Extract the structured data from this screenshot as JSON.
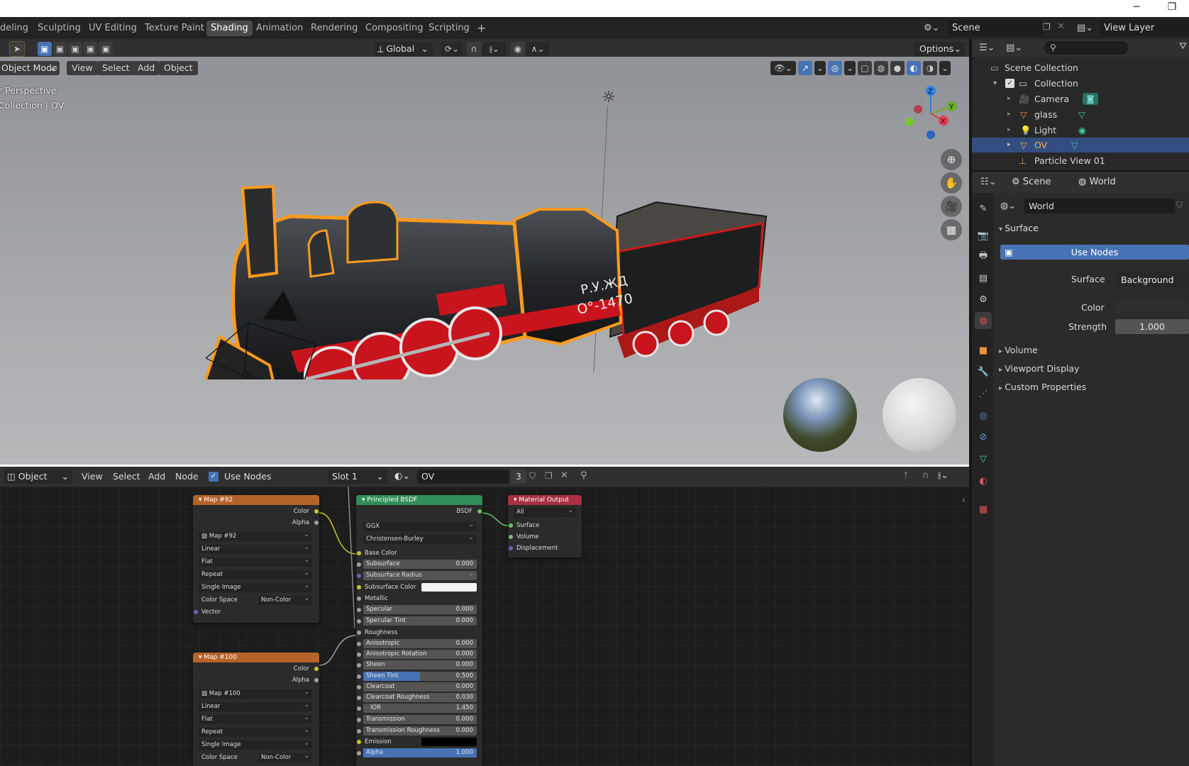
{
  "os": {
    "minimize": "─",
    "maximize": "❐"
  },
  "workspaces": [
    {
      "label": "deling",
      "active": false
    },
    {
      "label": "Sculpting",
      "active": false
    },
    {
      "label": "UV Editing",
      "active": false
    },
    {
      "label": "Texture Paint",
      "active": false
    },
    {
      "label": "Shading",
      "active": true
    },
    {
      "label": "Animation",
      "active": false
    },
    {
      "label": "Rendering",
      "active": false
    },
    {
      "label": "Compositing",
      "active": false
    },
    {
      "label": "Scripting",
      "active": false
    }
  ],
  "topbar": {
    "add_tab": "+",
    "scene_label": "Scene",
    "view_layer_label": "View Layer"
  },
  "viewport_header": {
    "transform_orientation": "Global",
    "options": "Options",
    "mode": "Object Mode",
    "menus": [
      "View",
      "Select",
      "Add",
      "Object"
    ]
  },
  "viewport": {
    "overlay_line1": "r Perspective",
    "overlay_line2": "Collection | OV",
    "gizmo": {
      "z": "Z",
      "y": "Y",
      "x": "X"
    },
    "train_plate": "Р.У.ЖД",
    "train_number": "О°-1470"
  },
  "node_header": {
    "editor_type": "Object",
    "menus": [
      "View",
      "Select",
      "Add",
      "Node"
    ],
    "use_nodes_label": "Use Nodes",
    "slot": "Slot 1",
    "material": "OV",
    "users": "3"
  },
  "nodes": {
    "map92": {
      "title": "Map #92",
      "out_color": "Color",
      "out_alpha": "Alpha",
      "image": "Map #92",
      "interpolation": "Linear",
      "projection": "Flat",
      "extension": "Repeat",
      "source": "Single Image",
      "color_space_label": "Color Space",
      "color_space": "Non-Color",
      "vector": "Vector"
    },
    "map100": {
      "title": "Map #100",
      "out_color": "Color",
      "out_alpha": "Alpha",
      "image": "Map #100",
      "interpolation": "Linear",
      "projection": "Flat",
      "extension": "Repeat",
      "source": "Single Image",
      "color_space_label": "Color Space",
      "color_space": "Non-Color"
    },
    "bsdf": {
      "title": "Principled BSDF",
      "out": "BSDF",
      "distribution": "GGX",
      "subsurface_method": "Christensen-Burley",
      "base_color": "Base Color",
      "subsurface_label": "Subsurface",
      "subsurface": "0.000",
      "subsurface_radius": "Subsurface Radius",
      "subsurface_color": "Subsurface Color",
      "metallic": "Metallic",
      "specular_label": "Specular",
      "specular": "0.000",
      "specular_tint_label": "Specular Tint",
      "specular_tint": "0.000",
      "roughness": "Roughness",
      "anisotropic_label": "Anisotropic",
      "anisotropic": "0.000",
      "anisotropic_rotation_label": "Anisotropic Rotation",
      "anisotropic_rotation": "0.000",
      "sheen_label": "Sheen",
      "sheen": "0.000",
      "sheen_tint_label": "Sheen Tint",
      "sheen_tint": "0.500",
      "clearcoat_label": "Clearcoat",
      "clearcoat": "0.000",
      "clearcoat_roughness_label": "Clearcoat Roughness",
      "clearcoat_roughness": "0.030",
      "ior_label": "IOR",
      "ior": "1.450",
      "transmission_label": "Transmission",
      "transmission": "0.000",
      "transmission_roughness_label": "Transmission Roughness",
      "transmission_roughness": "0.000",
      "emission": "Emission",
      "alpha_label": "Alpha",
      "alpha": "1.000"
    },
    "output": {
      "title": "Material Output",
      "target": "All",
      "surface": "Surface",
      "volume": "Volume",
      "displacement": "Displacement"
    }
  },
  "outliner": {
    "root": "Scene Collection",
    "collection": "Collection",
    "items": [
      {
        "label": "Camera",
        "selected": false
      },
      {
        "label": "glass",
        "selected": false
      },
      {
        "label": "Light",
        "selected": false
      },
      {
        "label": "OV",
        "selected": true
      },
      {
        "label": "Particle View 01",
        "selected": false
      }
    ]
  },
  "properties": {
    "crumb_scene": "Scene",
    "crumb_world": "World",
    "world_name": "World",
    "surface_panel": "Surface",
    "use_nodes": "Use Nodes",
    "surface_label": "Surface",
    "surface_value": "Background",
    "color_label": "Color",
    "strength_label": "Strength",
    "strength_value": "1.000",
    "collapsed_panels": [
      "Volume",
      "Viewport Display",
      "Custom Properties"
    ]
  },
  "colors": {
    "accent": "#4772b3",
    "selection_orange": "#ff9a1f",
    "texture_node_header": "#b5622b",
    "shader_node_header": "#2f8f57",
    "output_node_header": "#a83040"
  }
}
